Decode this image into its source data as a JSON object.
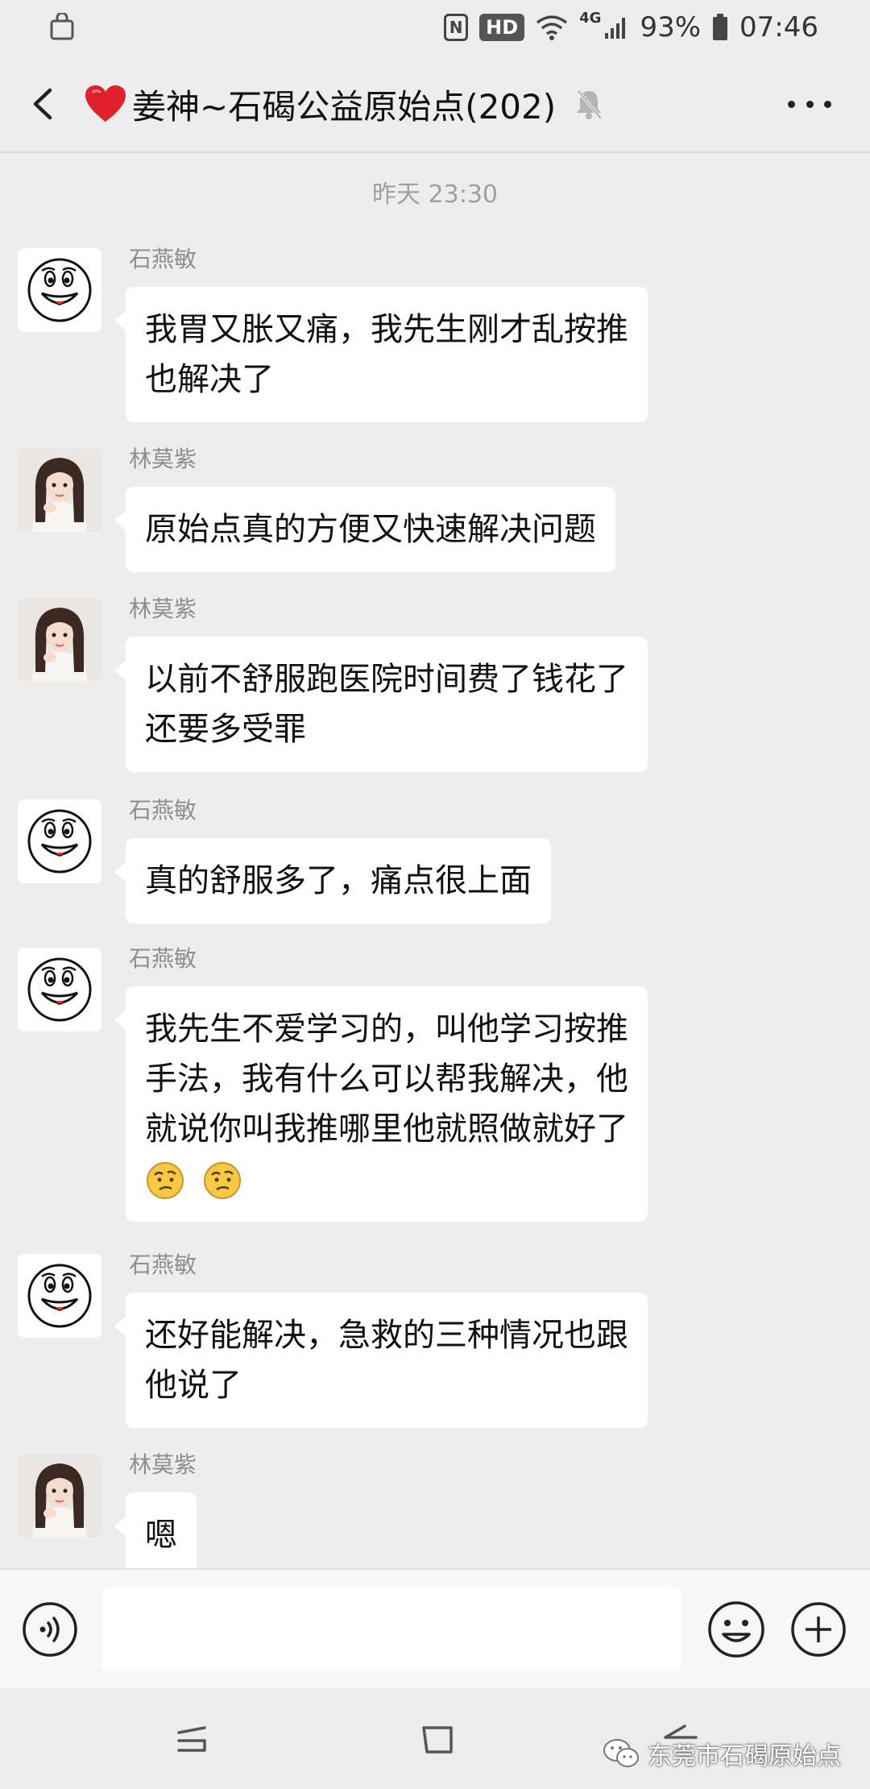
{
  "status_bar": {
    "nfc": "N",
    "hd_badge": "HD",
    "network": "4G",
    "battery": "93%",
    "time": "07:46"
  },
  "header": {
    "title": "姜神~石碣公益原始点(202)",
    "icons": [
      "back-arrow-icon",
      "heart-icon",
      "mute-bell-icon",
      "more-icon"
    ]
  },
  "chat": {
    "timestamp": "昨天 23:30",
    "messages": [
      {
        "sender": "石燕敏",
        "avatar": "smiley-face-avatar",
        "lines": [
          "我胃又胀又痛，我先生刚才乱按推",
          "也解决了"
        ]
      },
      {
        "sender": "林莫紫",
        "avatar": "girl-photo-avatar",
        "lines": [
          "原始点真的方便又快速解决问题"
        ]
      },
      {
        "sender": "林莫紫",
        "avatar": "girl-photo-avatar",
        "lines": [
          "以前不舒服跑医院时间费了钱花了",
          "还要多受罪"
        ]
      },
      {
        "sender": "石燕敏",
        "avatar": "smiley-face-avatar",
        "lines": [
          "真的舒服多了，痛点很上面"
        ]
      },
      {
        "sender": "石燕敏",
        "avatar": "smiley-face-avatar",
        "lines": [
          "我先生不爱学习的，叫他学习按推",
          "手法，我有什么可以帮我解决，他",
          "就说你叫我推哪里他就照做就好了"
        ],
        "emoji": [
          "puzzled-emoji",
          "puzzled-emoji"
        ]
      },
      {
        "sender": "石燕敏",
        "avatar": "smiley-face-avatar",
        "lines": [
          "还好能解决，急救的三种情况也跟",
          "他说了"
        ]
      },
      {
        "sender": "林莫紫",
        "avatar": "girl-photo-avatar",
        "lines": [
          "嗯"
        ]
      }
    ]
  },
  "input_bar": {
    "value": "",
    "icons": [
      "voice-icon",
      "emoji-icon",
      "plus-icon"
    ]
  },
  "nav_bar": {
    "icons": [
      "recent-apps-icon",
      "home-icon",
      "back-icon"
    ],
    "watermark": "东莞市石碣原始点"
  },
  "colors": {
    "background": "#ededed",
    "bubble": "#ffffff",
    "sender_name": "#8e8e8e",
    "heart": "#e0202a"
  }
}
